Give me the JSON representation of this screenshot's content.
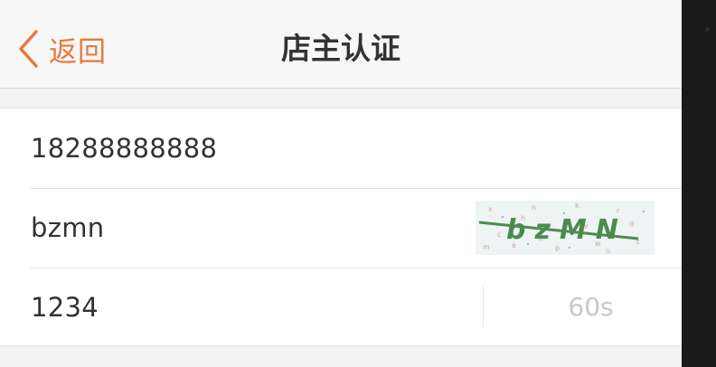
{
  "navbar": {
    "back_label": "返回",
    "title": "店主认证",
    "accent_color": "#e8793c"
  },
  "form": {
    "phone_value": "18288888888",
    "captcha_input_value": "bzmn",
    "captcha_image_text": "bzMN",
    "sms_code_value": "1234",
    "countdown_label": "60s"
  },
  "icons": {
    "back": "chevron-left-icon"
  }
}
